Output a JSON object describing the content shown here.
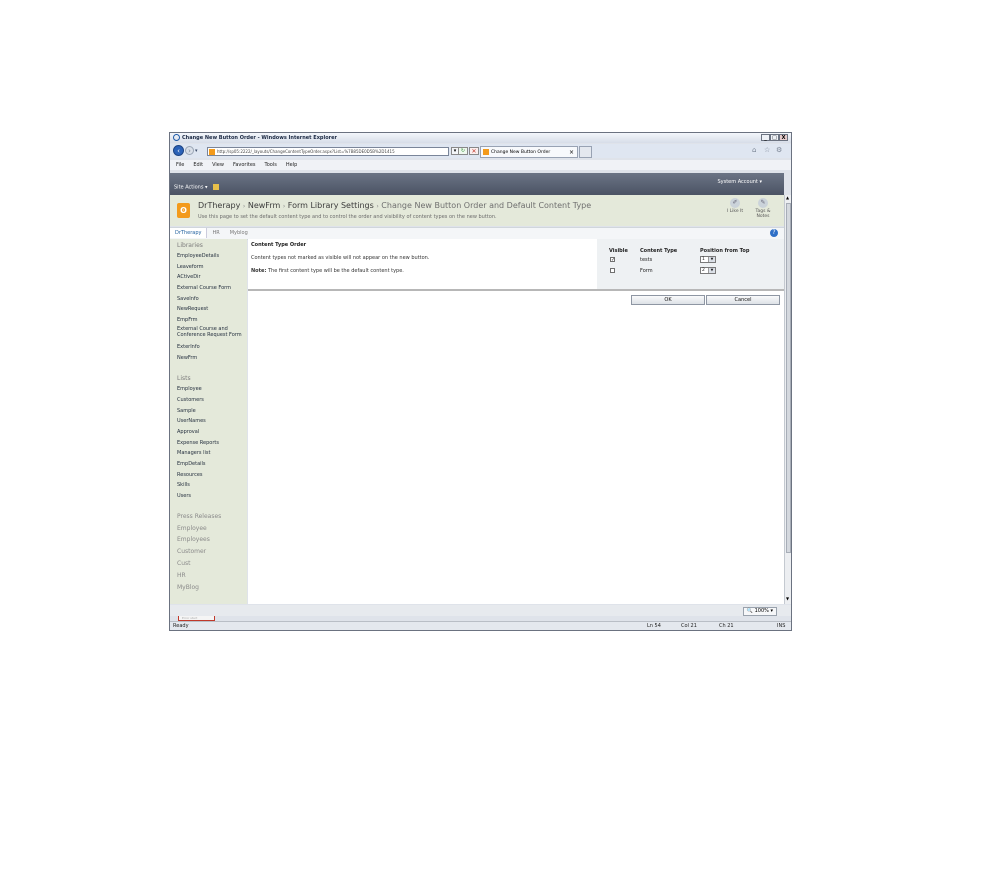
{
  "window": {
    "title": "Change New Button Order - Windows Internet Explorer",
    "controls": [
      "_",
      "□",
      "X"
    ]
  },
  "address_bar": {
    "url": "http://sp05:2222/_layouts/ChangeContentTypeOrder.aspx?List=%7B85DE0D5B%2D1415",
    "tab_title": "Change New Button Order",
    "tab_close": "×"
  },
  "menu_bar": [
    "File",
    "Edit",
    "View",
    "Favorites",
    "Tools",
    "Help"
  ],
  "ribbon": {
    "site_actions": "Site Actions ▾",
    "account": "System Account ▾"
  },
  "title_area": {
    "logo_glyph": "ʘ",
    "breadcrumb": [
      "DrTherapy",
      "NewFrm",
      "Form Library Settings"
    ],
    "separator": "›",
    "current_page": "Change New Button Order and Default Content Type",
    "description": "Use this page to set the default content type and to control the order and visibility of content types on the new button.",
    "like_label": "I Like It",
    "tags_label": "Tags & Notes"
  },
  "top_nav": {
    "items": [
      "DrTherapy",
      "HR",
      "Myblog"
    ],
    "help": "?"
  },
  "quick_launch": {
    "libraries_heading": "Libraries",
    "libraries": [
      "EmployeeDetails",
      "Leaveform",
      "ACtiveDir",
      "External Course Form",
      "SaveInfo",
      "NewRequest",
      "EmpFrm",
      "External Course and Conference Request Form",
      "ExterInfo",
      "NewFrm"
    ],
    "lists_heading": "Lists",
    "lists": [
      "Employee",
      "Customers",
      "Sample",
      "UserNames",
      "Approval",
      "Expense Reports",
      "Managers list",
      "EmpDetails",
      "Resources",
      "Skills",
      "Users"
    ],
    "pages": [
      "Press Releases",
      "Employee",
      "Employees",
      "Customer",
      "Cust",
      "HR",
      "MyBlog"
    ]
  },
  "content_type_order": {
    "section_title": "Content Type Order",
    "info": "Content types not marked as visible will not appear on the new button.",
    "note_label": "Note:",
    "note_text": "The first content type will be the default content type.",
    "headers": {
      "visible": "Visible",
      "content_type": "Content Type",
      "position": "Position from Top"
    },
    "rows": [
      {
        "visible": true,
        "name": "tests",
        "position": "1"
      },
      {
        "visible": false,
        "name": "Form",
        "position": "2"
      }
    ]
  },
  "buttons": {
    "ok": "OK",
    "cancel": "Cancel"
  },
  "zoom": "🔍 100%  ▾",
  "status_bar": {
    "state": "Ready",
    "ln": "Ln 54",
    "col": "Col 21",
    "ch": "Ch 21",
    "mode": "INS"
  },
  "taskbar_fragment": "Error start"
}
